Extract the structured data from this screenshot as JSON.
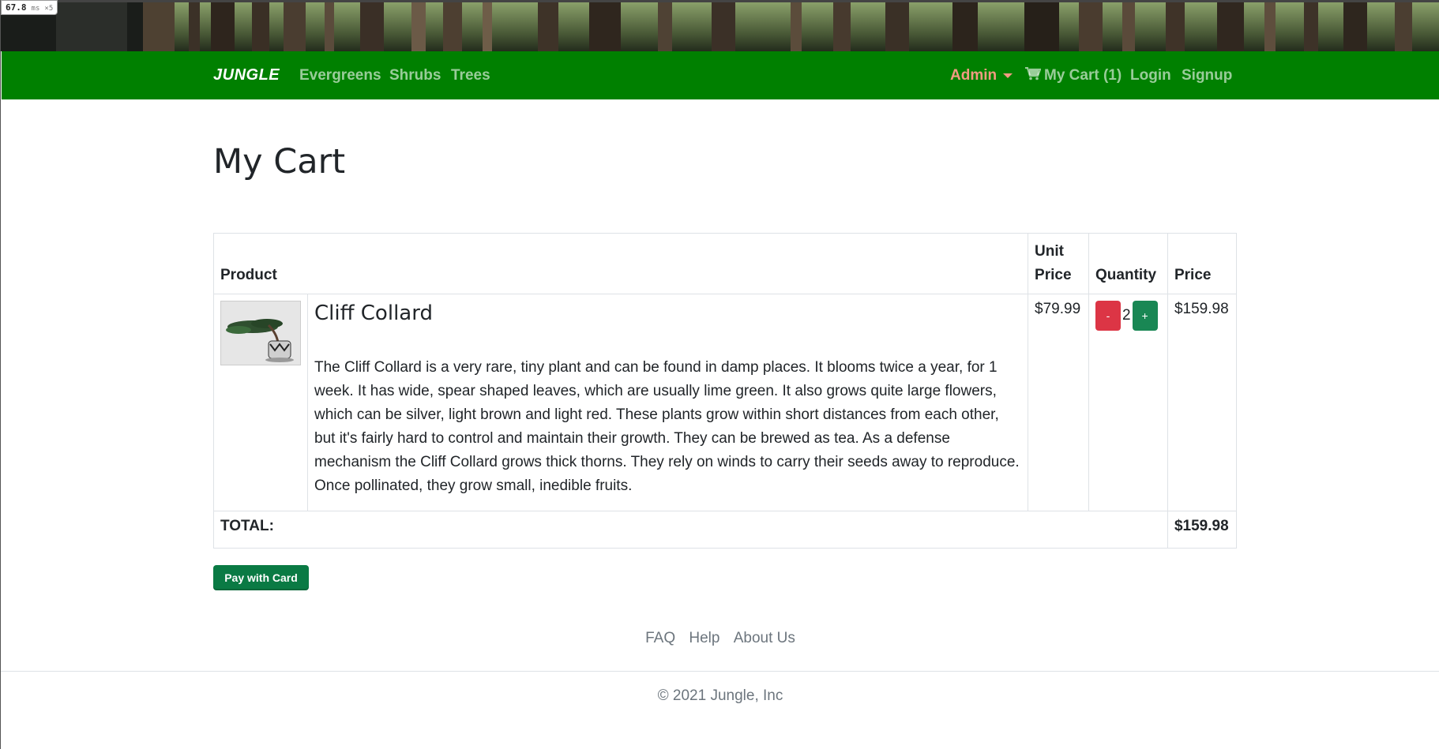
{
  "perf": {
    "value": "67.8",
    "unit": "ms",
    "mult": "×5"
  },
  "nav": {
    "brand": "JUNGLE",
    "links": [
      "Evergreens",
      "Shrubs",
      "Trees"
    ],
    "admin": "Admin",
    "cart": "My Cart (1)",
    "login": "Login",
    "signup": "Signup"
  },
  "page": {
    "title": "My Cart"
  },
  "table": {
    "headers": {
      "product": "Product",
      "unit_price": "Unit Price",
      "quantity": "Quantity",
      "price": "Price"
    },
    "items": [
      {
        "name": "Cliff Collard",
        "description": "The Cliff Collard is a very rare, tiny plant and can be found in damp places. It blooms twice a year, for 1 week. It has wide, spear shaped leaves, which are usually lime green. It also grows quite large flowers, which can be silver, light brown and light red. These plants grow within short distances from each other, but it's fairly hard to control and maintain their growth. They can be brewed as tea. As a defense mechanism the Cliff Collard grows thick thorns. They rely on winds to carry their seeds away to reproduce. Once pollinated, they grow small, inedible fruits.",
        "unit_price": "$79.99",
        "minus_label": "-",
        "quantity": "2",
        "plus_label": "+",
        "price": "$159.98"
      }
    ],
    "total_label": "TOTAL:",
    "total_value": "$159.98"
  },
  "pay_button": "Pay with Card",
  "footer": {
    "links": [
      "FAQ",
      "Help",
      "About Us"
    ],
    "copyright": "© 2021 Jungle, Inc"
  },
  "colors": {
    "nav_bg": "#008000",
    "admin": "#f39b82",
    "minus": "#dc3545",
    "plus": "#198754",
    "pay": "#0a7a44"
  }
}
